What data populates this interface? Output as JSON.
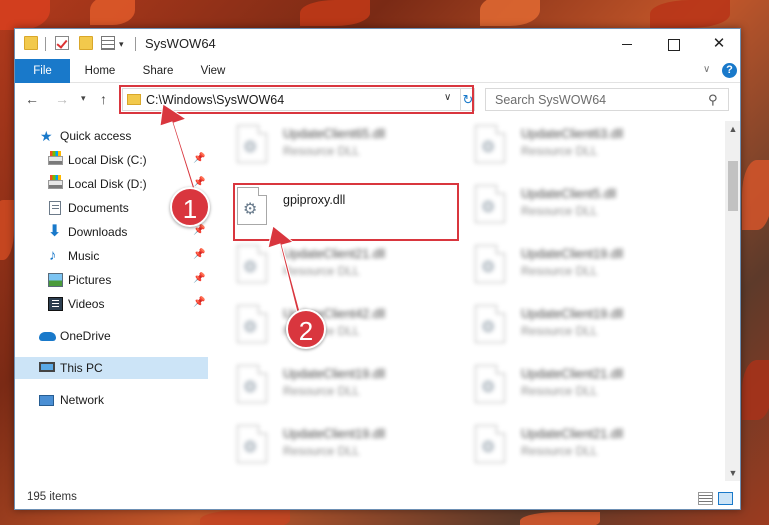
{
  "window": {
    "title": "SysWOW64",
    "controls": {
      "minimize": "",
      "maximize": "",
      "close": "✕"
    }
  },
  "ribbon": {
    "tabs": [
      "File",
      "Home",
      "Share",
      "View"
    ],
    "help": "?"
  },
  "address": {
    "path": "C:\\Windows\\SysWOW64",
    "refresh": "↻"
  },
  "search": {
    "placeholder": "Search SysWOW64"
  },
  "sidebar": {
    "items": [
      {
        "label": "Quick access",
        "pinned": false
      },
      {
        "label": "Local Disk (C:)",
        "pinned": true
      },
      {
        "label": "Local Disk (D:)",
        "pinned": true
      },
      {
        "label": "Documents",
        "pinned": true
      },
      {
        "label": "Downloads",
        "pinned": true
      },
      {
        "label": "Music",
        "pinned": true
      },
      {
        "label": "Pictures",
        "pinned": true
      },
      {
        "label": "Videos",
        "pinned": true
      },
      {
        "label": "OneDrive",
        "pinned": false
      },
      {
        "label": "This PC",
        "pinned": false,
        "selected": true
      },
      {
        "label": "Network",
        "pinned": false
      }
    ]
  },
  "files": {
    "left": [
      {
        "name": "UpdateClient65.dll",
        "type": "Resource DLL"
      },
      {
        "name": "gpiproxy.dll",
        "type": ""
      },
      {
        "name": "UpdateClient21.dll",
        "type": "Resource DLL"
      },
      {
        "name": "UpdateClient42.dll",
        "type": "Resource DLL"
      },
      {
        "name": "UpdateClient19.dll",
        "type": "Resource DLL"
      },
      {
        "name": "UpdateClient19.dll",
        "type": "Resource DLL"
      }
    ],
    "right": [
      {
        "name": "UpdateClient63.dll",
        "type": "Resource DLL"
      },
      {
        "name": "UpdateClient5.dll",
        "type": "Resource DLL"
      },
      {
        "name": "UpdateClient19.dll",
        "type": "Resource DLL"
      },
      {
        "name": "UpdateClient19.dll",
        "type": "Resource DLL"
      },
      {
        "name": "UpdateClient21.dll",
        "type": "Resource DLL"
      },
      {
        "name": "UpdateClient21.dll",
        "type": "Resource DLL"
      }
    ]
  },
  "status": {
    "item_count": "195 items"
  },
  "annotations": {
    "step1": "1",
    "step2": "2",
    "color": "#d9363e"
  }
}
